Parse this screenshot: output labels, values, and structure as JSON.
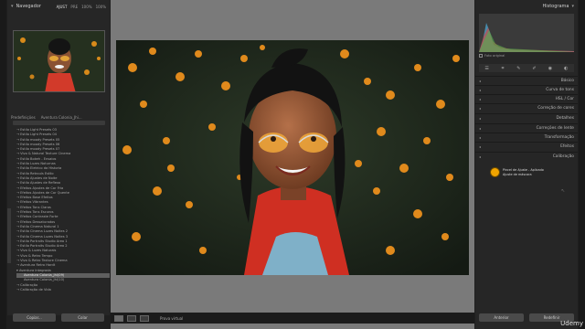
{
  "navigator": {
    "title": "Navegador",
    "zoom": [
      "AJUST",
      "PRE",
      "100%",
      "100%"
    ]
  },
  "presets": {
    "header": "Predefinições",
    "user_label": "Aventura Colonia_Jhi...",
    "search_placeholder": "Pesquisar",
    "items": [
      {
        "label": "→ Estilo Light Presets 03",
        "kind": "item"
      },
      {
        "label": "→ Estilo Light Presets 04",
        "kind": "item"
      },
      {
        "label": "→ Estilo moody Presets 05",
        "kind": "item"
      },
      {
        "label": "→ Estilo moody Presets 06",
        "kind": "item"
      },
      {
        "label": "→ Estilo moody Presets 07",
        "kind": "item"
      },
      {
        "label": "→ Vivo & Natural Texture Cinema",
        "kind": "item"
      },
      {
        "label": "→ Estilo Bokeh - Ensaios",
        "kind": "item"
      },
      {
        "label": "→ Estilo Luzes Noturnas",
        "kind": "item"
      },
      {
        "label": "→ Estilo Eletrico da Historia",
        "kind": "item"
      },
      {
        "label": "→ Estilo Retrouls Estilo",
        "kind": "item"
      },
      {
        "label": "→ Estilo Ajustes de Noite",
        "kind": "item"
      },
      {
        "label": "→ Estilo Ajustes de Reflexo",
        "kind": "item"
      },
      {
        "label": "→ Efeitos Ajustes de Cor Fria",
        "kind": "item"
      },
      {
        "label": "→ Efeitos Ajustes de Cor Quente",
        "kind": "item"
      },
      {
        "label": "→ Efeitos Base Efeitos",
        "kind": "item"
      },
      {
        "label": "→ Efeitos Vibrantes",
        "kind": "item"
      },
      {
        "label": "→ Efeitos Tons Claros",
        "kind": "item"
      },
      {
        "label": "→ Efeitos Tons Escuros",
        "kind": "item"
      },
      {
        "label": "→ Efeitos Contraste Forte",
        "kind": "item"
      },
      {
        "label": "→ Efeitos Dessaturados",
        "kind": "item"
      },
      {
        "label": "→ Estilo Cinema Natural 1",
        "kind": "item"
      },
      {
        "label": "→ Estilo Cinema Luzes Noites 2",
        "kind": "item"
      },
      {
        "label": "→ Estilo Cinema Luzes Noites 3",
        "kind": "item"
      },
      {
        "label": "→ Estilo Portraits Studio Area 1",
        "kind": "item"
      },
      {
        "label": "→ Estilo Portraits Studio Area 2",
        "kind": "item"
      },
      {
        "label": "→ Vivo & Luzes Naturais",
        "kind": "item"
      },
      {
        "label": "→ Vivo & Retro Tempo",
        "kind": "item"
      },
      {
        "label": "→ Vivo & Retro Texture Cinema",
        "kind": "item"
      },
      {
        "label": "→ Aventura Retro Hardt",
        "kind": "item"
      },
      {
        "label": "▾ Aventura Integrada",
        "kind": "group"
      },
      {
        "label": "Aventura Colonia_Jhi(09)",
        "kind": "selected"
      },
      {
        "label": "Aventura Colonia_Jhi(10)",
        "kind": "sub"
      },
      {
        "label": "→ Calibração",
        "kind": "item"
      },
      {
        "label": "→ Calibração de Vida",
        "kind": "item"
      }
    ]
  },
  "left_buttons": {
    "copy": "Copiar...",
    "paste": "Colar"
  },
  "toolbar": {
    "soft_proof": "Prova virtual"
  },
  "histogram": {
    "title": "Histograma"
  },
  "right_panels": [
    {
      "label": "Básico"
    },
    {
      "label": "Curva de tons"
    },
    {
      "label": "HSL / Cor"
    },
    {
      "label": "Correção de cores"
    },
    {
      "label": "Detalhes"
    },
    {
      "label": "Correções de lente"
    },
    {
      "label": "Transformação"
    },
    {
      "label": "Efeitos"
    },
    {
      "label": "Calibração"
    }
  ],
  "original_photo": "Foto original",
  "pin_tooltip": {
    "line1": "Pincel de Ajuste - Aplicado",
    "line2": "Ajuste de máscara"
  },
  "right_buttons": {
    "previous": "Anterior",
    "reset": "Redefinir"
  },
  "watermark": "Udemy",
  "colors": {
    "accent": "#f0a400",
    "panel": "#262626",
    "canvas": "#7a7a7a"
  }
}
